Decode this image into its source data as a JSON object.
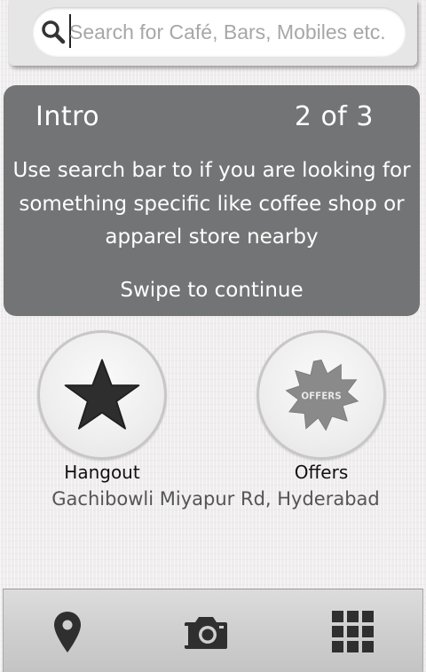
{
  "search": {
    "placeholder": "Search for Café, Bars, Mobiles etc.",
    "value": "",
    "icon": "search-icon"
  },
  "intro": {
    "title": "Intro",
    "step": "2 of 3",
    "body": "Use search bar to if you are looking for something specific like coffee shop or apparel store nearby",
    "swipe_hint": "Swipe to continue",
    "background": "#737475"
  },
  "actions": [
    {
      "label": "Hangout",
      "icon": "star-icon"
    },
    {
      "label": "Offers",
      "icon": "offers-badge-icon",
      "badge_text": "OFFERS"
    }
  ],
  "location": "Gachibowli Miyapur Rd, Hyderabad",
  "bottom_nav": [
    {
      "icon": "location-pin-icon"
    },
    {
      "icon": "camera-icon"
    },
    {
      "icon": "grid-menu-icon"
    }
  ]
}
